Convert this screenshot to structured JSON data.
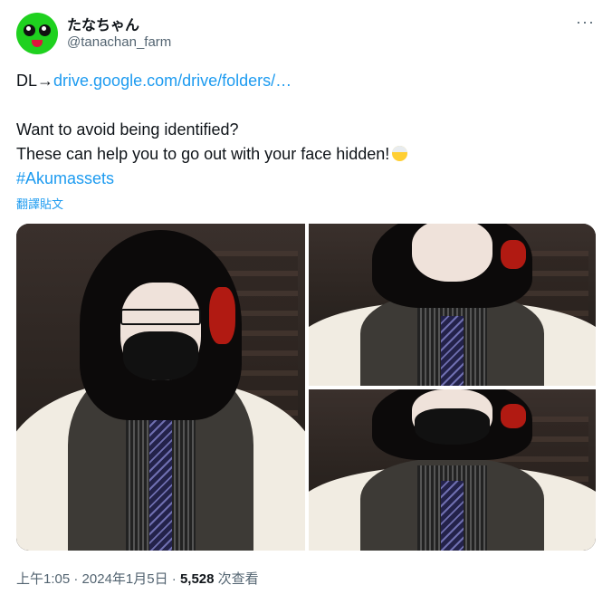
{
  "author": {
    "display_name": "たなちゃん",
    "handle": "@tanachan_farm"
  },
  "menu_icon": "more-horizontal-icon",
  "tweet": {
    "prefix": "DL→",
    "link_text": "drive.google.com/drive/folders/…",
    "line1": "Want to avoid being identified?",
    "line2": "These can help you to go out with your face hidden!",
    "emoji_icon": "face-with-bandage-emoji",
    "hashtag": "#Akumassets",
    "translate_label": "翻譯貼文"
  },
  "media": {
    "images": [
      {
        "subject": "masked-glasses-portrait"
      },
      {
        "subject": "smiling-portrait"
      },
      {
        "subject": "masked-portrait"
      }
    ]
  },
  "footer": {
    "time": "上午1:05",
    "separator": "·",
    "date": "2024年1月5日",
    "views_count": "5,528",
    "views_label": "次查看"
  },
  "colors": {
    "link": "#1d9bf0",
    "text": "#0f1419",
    "muted": "#536471",
    "avatar": "#1fd11f"
  }
}
